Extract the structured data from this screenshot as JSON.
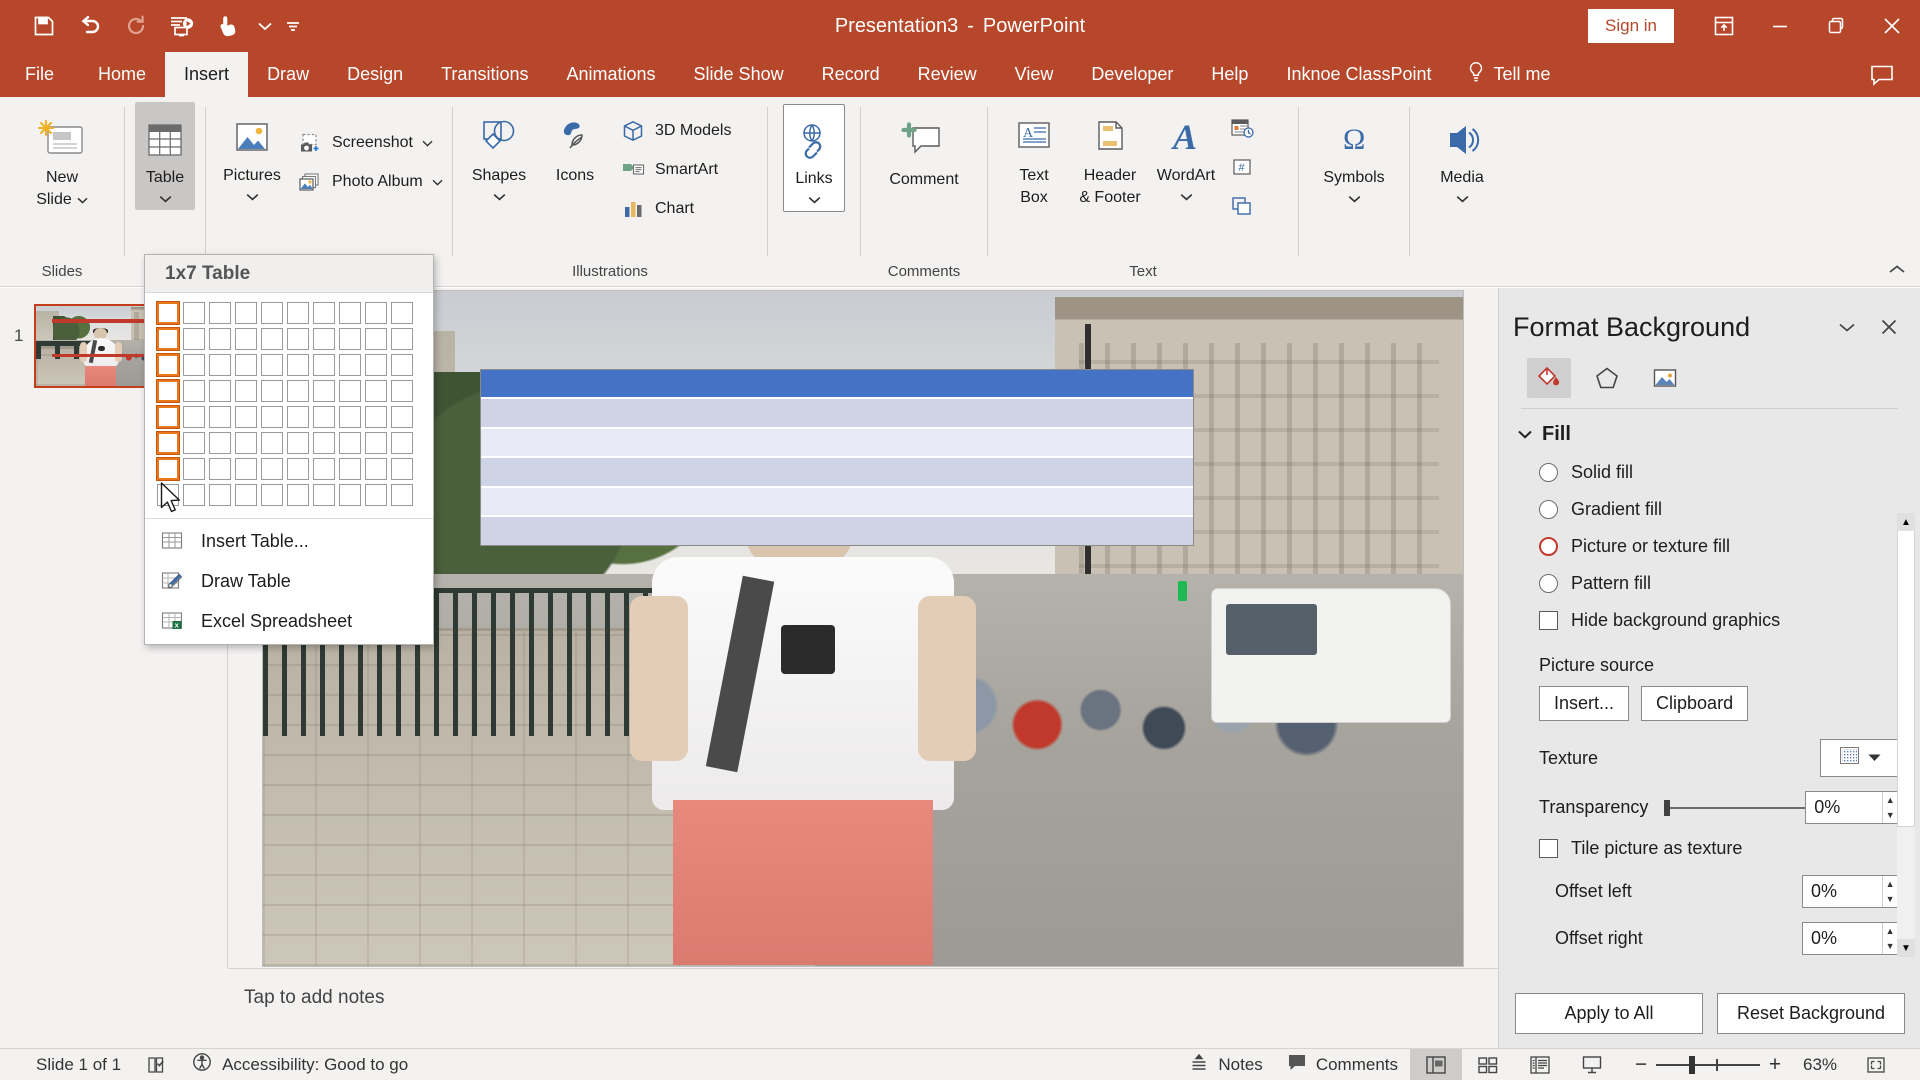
{
  "titlebar": {
    "document_name": "Presentation3",
    "separator": "-",
    "app_name": "PowerPoint",
    "signin_label": "Sign in",
    "qat": [
      {
        "name": "save-icon",
        "label": "Save"
      },
      {
        "name": "undo-icon",
        "label": "Undo"
      },
      {
        "name": "redo-icon",
        "label": "Redo"
      },
      {
        "name": "start-from-beginning-icon",
        "label": "Start From Beginning"
      },
      {
        "name": "touch-mode-icon",
        "label": "Touch/Mouse Mode"
      }
    ],
    "window_controls": [
      {
        "name": "ribbon-display-options-icon",
        "label": "Ribbon Display Options"
      },
      {
        "name": "minimize-icon",
        "label": "Minimize"
      },
      {
        "name": "restore-icon",
        "label": "Restore Down"
      },
      {
        "name": "close-icon",
        "label": "Close"
      }
    ]
  },
  "tabs": [
    {
      "label": "File",
      "active": false
    },
    {
      "label": "Home",
      "active": false
    },
    {
      "label": "Insert",
      "active": true
    },
    {
      "label": "Draw",
      "active": false
    },
    {
      "label": "Design",
      "active": false
    },
    {
      "label": "Transitions",
      "active": false
    },
    {
      "label": "Animations",
      "active": false
    },
    {
      "label": "Slide Show",
      "active": false
    },
    {
      "label": "Record",
      "active": false
    },
    {
      "label": "Review",
      "active": false
    },
    {
      "label": "View",
      "active": false
    },
    {
      "label": "Developer",
      "active": false
    },
    {
      "label": "Help",
      "active": false
    },
    {
      "label": "Inknoe ClassPoint",
      "active": false
    }
  ],
  "tellme": {
    "label": "Tell me"
  },
  "ribbon": {
    "groups": [
      {
        "name": "slides",
        "label": "Slides",
        "buttons": [
          {
            "label_line1": "New",
            "label_line2": "Slide",
            "icon": "new-slide-icon",
            "dropdown": true
          }
        ]
      },
      {
        "name": "tables",
        "label": "",
        "buttons": [
          {
            "label_line1": "Table",
            "icon": "table-icon",
            "dropdown": true,
            "checked": true
          }
        ]
      },
      {
        "name": "images",
        "label": "",
        "big": [
          {
            "label_line1": "Pictures",
            "icon": "pictures-icon",
            "dropdown": true
          }
        ],
        "small": [
          {
            "label": "Screenshot",
            "icon": "screenshot-icon",
            "dropdown": true
          },
          {
            "label": "Photo Album",
            "icon": "photo-album-icon",
            "dropdown": true
          }
        ]
      },
      {
        "name": "illustrations",
        "label": "Illustrations",
        "big": [
          {
            "label_line1": "Shapes",
            "icon": "shapes-icon",
            "dropdown": true
          },
          {
            "label_line1": "Icons",
            "icon": "icons-icon",
            "dropdown": false
          }
        ],
        "small": [
          {
            "label": "3D Models",
            "icon": "3d-models-icon",
            "dropdown": true
          },
          {
            "label": "SmartArt",
            "icon": "smartart-icon",
            "dropdown": false
          },
          {
            "label": "Chart",
            "icon": "chart-icon",
            "dropdown": false
          }
        ]
      },
      {
        "name": "links",
        "label": "",
        "buttons": [
          {
            "label_line1": "Links",
            "icon": "links-icon",
            "dropdown": true
          }
        ]
      },
      {
        "name": "comments",
        "label": "Comments",
        "buttons": [
          {
            "label_line1": "Comment",
            "icon": "comment-icon",
            "dropdown": false
          }
        ]
      },
      {
        "name": "text",
        "label": "Text",
        "buttons": [
          {
            "label_line1": "Text",
            "label_line2": "Box",
            "icon": "text-box-icon",
            "dropdown": false
          },
          {
            "label_line1": "Header",
            "label_line2": "& Footer",
            "icon": "header-footer-icon",
            "dropdown": false
          },
          {
            "label_line1": "WordArt",
            "icon": "wordart-icon",
            "dropdown": true
          }
        ],
        "mini": [
          {
            "name": "date-time-icon",
            "label": "Date & Time"
          },
          {
            "name": "slide-number-icon",
            "label": "Slide Number"
          },
          {
            "name": "object-icon",
            "label": "Object"
          }
        ]
      },
      {
        "name": "symbols",
        "label": "",
        "buttons": [
          {
            "label_line1": "Symbols",
            "icon": "symbols-icon",
            "dropdown": true
          }
        ]
      },
      {
        "name": "media",
        "label": "",
        "buttons": [
          {
            "label_line1": "Media",
            "icon": "media-icon",
            "dropdown": true
          }
        ]
      }
    ]
  },
  "table_dropdown": {
    "header": "1x7 Table",
    "grid": {
      "columns": 10,
      "rows": 8,
      "selected_columns": 1,
      "selected_rows": 7
    },
    "items": [
      {
        "label": "Insert Table...",
        "icon": "insert-table-icon",
        "accel": "I"
      },
      {
        "label": "Draw Table",
        "icon": "draw-table-icon",
        "accel": "D"
      },
      {
        "label": "Excel Spreadsheet",
        "icon": "excel-spreadsheet-icon",
        "accel": "x"
      }
    ]
  },
  "slides_pane": {
    "slides": [
      {
        "number": "1"
      }
    ]
  },
  "slide": {
    "table_rows": [
      "#4472c4",
      "#ced4e6",
      "#e7eaf4",
      "#ced4e6",
      "#e7eaf4",
      "#ced4e6"
    ]
  },
  "notes": {
    "placeholder": "Tap to add notes"
  },
  "format_background": {
    "title": "Format Background",
    "tabs": [
      {
        "name": "fill-tab",
        "icon": "paint-bucket-icon",
        "active": true
      },
      {
        "name": "effects-tab",
        "icon": "pentagon-icon",
        "active": false
      },
      {
        "name": "picture-tab",
        "icon": "picture-icon",
        "active": false
      }
    ],
    "section_label": "Fill",
    "fill_options": [
      {
        "label": "Solid fill",
        "accel": "S",
        "selected": false
      },
      {
        "label": "Gradient fill",
        "accel": "G",
        "selected": false
      },
      {
        "label": "Picture or texture fill",
        "accel": "P",
        "selected": true
      },
      {
        "label": "Pattern fill",
        "accel": "a",
        "selected": false
      }
    ],
    "hide_background_graphics": {
      "label": "Hide background graphics",
      "accel": "H",
      "checked": false
    },
    "picture_source_label": "Picture source",
    "insert_button": "Insert...",
    "clipboard_button": "Clipboard",
    "texture_label": "Texture",
    "transparency_label": "Transparency",
    "transparency_value": "0%",
    "tile_picture_label": "Tile picture as texture",
    "tile_picture_checked": false,
    "offset_left_label": "Offset left",
    "offset_left_value": "0%",
    "offset_right_label": "Offset right",
    "offset_right_value": "0%",
    "apply_to_all": "Apply to All",
    "reset_background": "Reset Background",
    "accent_color": "#c0392b"
  },
  "statusbar": {
    "slide_counter": "Slide 1 of 1",
    "accessibility": "Accessibility: Good to go",
    "notes_label": "Notes",
    "comments_label": "Comments",
    "zoom_percent": "63%",
    "views": [
      {
        "name": "normal-view-button",
        "label": "Normal",
        "active": true
      },
      {
        "name": "slide-sorter-button",
        "label": "Slide Sorter",
        "active": false
      },
      {
        "name": "reading-view-button",
        "label": "Reading View",
        "active": false
      },
      {
        "name": "slideshow-button",
        "label": "Slide Show",
        "active": false
      }
    ],
    "fit_slide_label": "Fit slide to current window"
  }
}
